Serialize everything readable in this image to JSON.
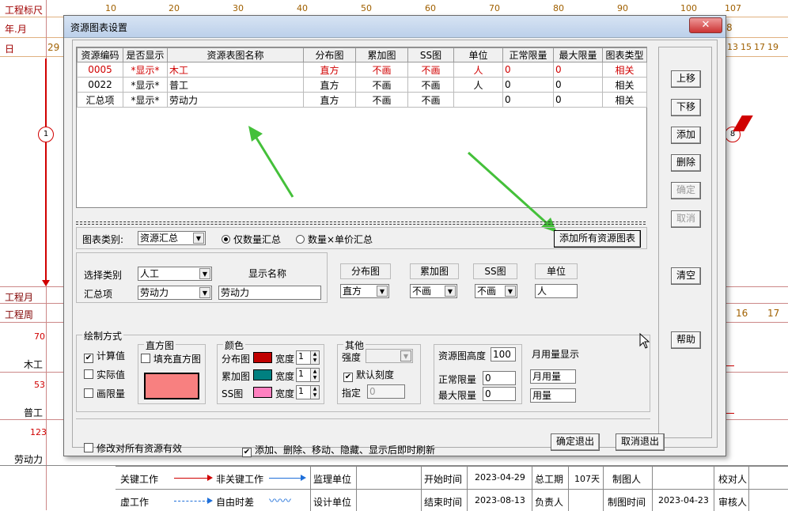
{
  "background": {
    "ruler_label": "工程标尺",
    "year_month_label": "年.月",
    "day_label": "日",
    "day_first": "29",
    "ruler_ticks": [
      "10",
      "20",
      "30",
      "40",
      "50",
      "60",
      "70",
      "80",
      "90",
      "100",
      "107"
    ],
    "day_right": [
      "13",
      "15",
      "17",
      "19"
    ],
    "day_right_8": "8",
    "project_month_label": "工程月",
    "project_week_label": "工程周",
    "week_right": [
      "16",
      "17"
    ],
    "node_1": "1",
    "node_8": "8",
    "res_values": [
      "70",
      "53",
      "123"
    ],
    "res_names": [
      "木工",
      "普工",
      "劳动力"
    ],
    "legend": {
      "key_work": "关键工作",
      "nonkey_work": "非关键工作",
      "virtual_work": "虚工作",
      "free_float": "自由时差",
      "supervisor": "监理单位",
      "designer": "设计单位",
      "start_time_label": "开始时间",
      "start_time": "2023-04-29",
      "end_time_label": "结束时间",
      "end_time": "2023-08-13",
      "total_period_label": "总工期",
      "total_period": "107天",
      "owner_label": "负责人",
      "drawer_label": "制图人",
      "draw_time_label": "制图时间",
      "draw_time": "2023-04-23",
      "checker_label": "校对人",
      "reviewer_label": "审核人"
    }
  },
  "dialog": {
    "title": "资源图表设置",
    "close": "✕",
    "table": {
      "headers": [
        "资源编码",
        "是否显示",
        "资源表图名称",
        "分布图",
        "累加图",
        "SS图",
        "单位",
        "正常限量",
        "最大限量",
        "图表类型"
      ],
      "rows": [
        [
          "0005",
          "*显示*",
          "木工",
          "直方",
          "不画",
          "不画",
          "人",
          "0",
          "0",
          "相关"
        ],
        [
          "0022",
          "*显示*",
          "普工",
          "直方",
          "不画",
          "不画",
          "人",
          "0",
          "0",
          "相关"
        ],
        [
          "汇总项",
          "*显示*",
          "劳动力",
          "直方",
          "不画",
          "不画",
          "",
          "0",
          "0",
          "相关"
        ]
      ]
    },
    "side_buttons": {
      "up": "上移",
      "down": "下移",
      "add": "添加",
      "delete": "删除",
      "confirm": "确定",
      "cancel": "取消",
      "clear": "清空",
      "help": "帮助"
    },
    "chart_category_label": "图表类别:",
    "chart_category_value": "资源汇总",
    "radio_qty": "仅数量汇总",
    "radio_price": "数量×单价汇总",
    "add_all_button": "添加所有资源图表",
    "select_type_label": "选择类别",
    "select_type_value": "人工",
    "summary_label": "汇总项",
    "summary_value": "劳动力",
    "display_name_label": "显示名称",
    "display_name_value": "劳动力",
    "dist_label": "分布图",
    "dist_value": "直方",
    "cum_label": "累加图",
    "cum_value": "不画",
    "ss_label": "SS图",
    "ss_value": "不画",
    "unit_label": "单位",
    "unit_value": "人",
    "draw_mode_label": "绘制方式",
    "calc_value": "计算值",
    "actual_value": "实际值",
    "draw_limit": "画限量",
    "histogram_label": "直方图",
    "fill_histogram": "填充直方图",
    "color_label": "颜色",
    "color_dist": "分布图",
    "color_cum": "累加图",
    "color_ss": "SS图",
    "width_label": "宽度",
    "width_values": [
      "1",
      "1",
      "1"
    ],
    "colors": {
      "fill": "#f88080",
      "dist": "#c00000",
      "cum": "#008080",
      "ss": "#ff80c0"
    },
    "other_label": "其他",
    "intensity_label": "强度",
    "default_scale": "默认刻度",
    "specify_label": "指定",
    "specify_value": "0",
    "res_height_label": "资源图高度",
    "res_height_value": "100",
    "normal_limit_label": "正常限量",
    "normal_limit_value": "0",
    "max_limit_label": "最大限量",
    "max_limit_value": "0",
    "monthly_label": "月用量显示",
    "monthly_value": "月用量",
    "usage_value": "用量",
    "apply_all": "修改对所有资源有效",
    "refresh_after": "添加、删除、移动、隐藏、显示后即时刷新",
    "ok_exit": "确定退出",
    "cancel_exit": "取消退出"
  }
}
